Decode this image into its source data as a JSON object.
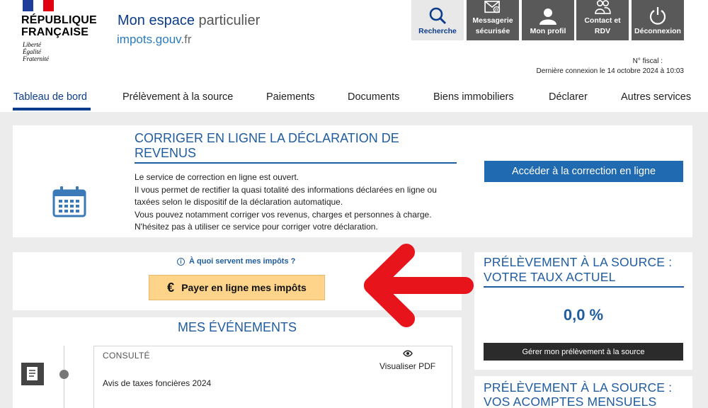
{
  "header": {
    "republique_line1": "RÉPUBLIQUE",
    "republique_line2": "FRANÇAISE",
    "devise": [
      "Liberté",
      "Égalité",
      "Fraternité"
    ],
    "espace_main": "Mon espace",
    "espace_light": "particulier",
    "domain_main": "impots.gouv",
    "domain_suffix": ".fr",
    "fiscal_label": "N° fiscal :",
    "last_connection": "Dernière connexion le 14 octobre 2024 à 10:03"
  },
  "toolbar": {
    "recherche": "Recherche",
    "messagerie_1": "Messagerie",
    "messagerie_2": "sécurisée",
    "profil": "Mon profil",
    "contact_1": "Contact et",
    "contact_2": "RDV",
    "deconnexion": "Déconnexion"
  },
  "nav": {
    "items": [
      "Tableau de bord",
      "Prélèvement à la source",
      "Paiements",
      "Documents",
      "Biens immobiliers",
      "Déclarer",
      "Autres services"
    ],
    "active_index": 0
  },
  "correction": {
    "title": "CORRIGER EN LIGNE LA DÉCLARATION DE REVENUS",
    "body": [
      "Le service de correction en ligne est ouvert.",
      "Il vous permet de rectifier la quasi totalité des informations déclarées en ligne ou taxées selon le dispositif de la déclaration automatique.",
      "Vous pouvez notamment corriger vos revenus, charges et personnes à charge.",
      "N'hésitez pas à utiliser ce service pour corriger votre déclaration."
    ],
    "button": "Accéder à la correction en ligne"
  },
  "pay": {
    "info_link": "À quoi servent mes impôts ?",
    "euro": "€",
    "button": "Payer en ligne mes impôts"
  },
  "events": {
    "title": "MES ÉVÉNEMENTS",
    "status": "CONSULTÉ",
    "view_label": "Visualiser  PDF",
    "item": "Avis de taxes foncières 2024"
  },
  "pas_rate": {
    "title": "PRÉLÈVEMENT À LA SOURCE : VOTRE TAUX ACTUEL",
    "rate": "0,0 %",
    "button": "Gérer mon prélèvement à la source"
  },
  "pas_acomptes": {
    "title": "PRÉLÈVEMENT À LA SOURCE : VOS ACOMPTES MENSUELS"
  },
  "colors": {
    "primary_blue": "#1f5ca0",
    "navy": "#0c3c8c",
    "pay_button": "#fdd48a",
    "arrow_red": "#e8141b",
    "toolbar_dark": "#595959"
  }
}
